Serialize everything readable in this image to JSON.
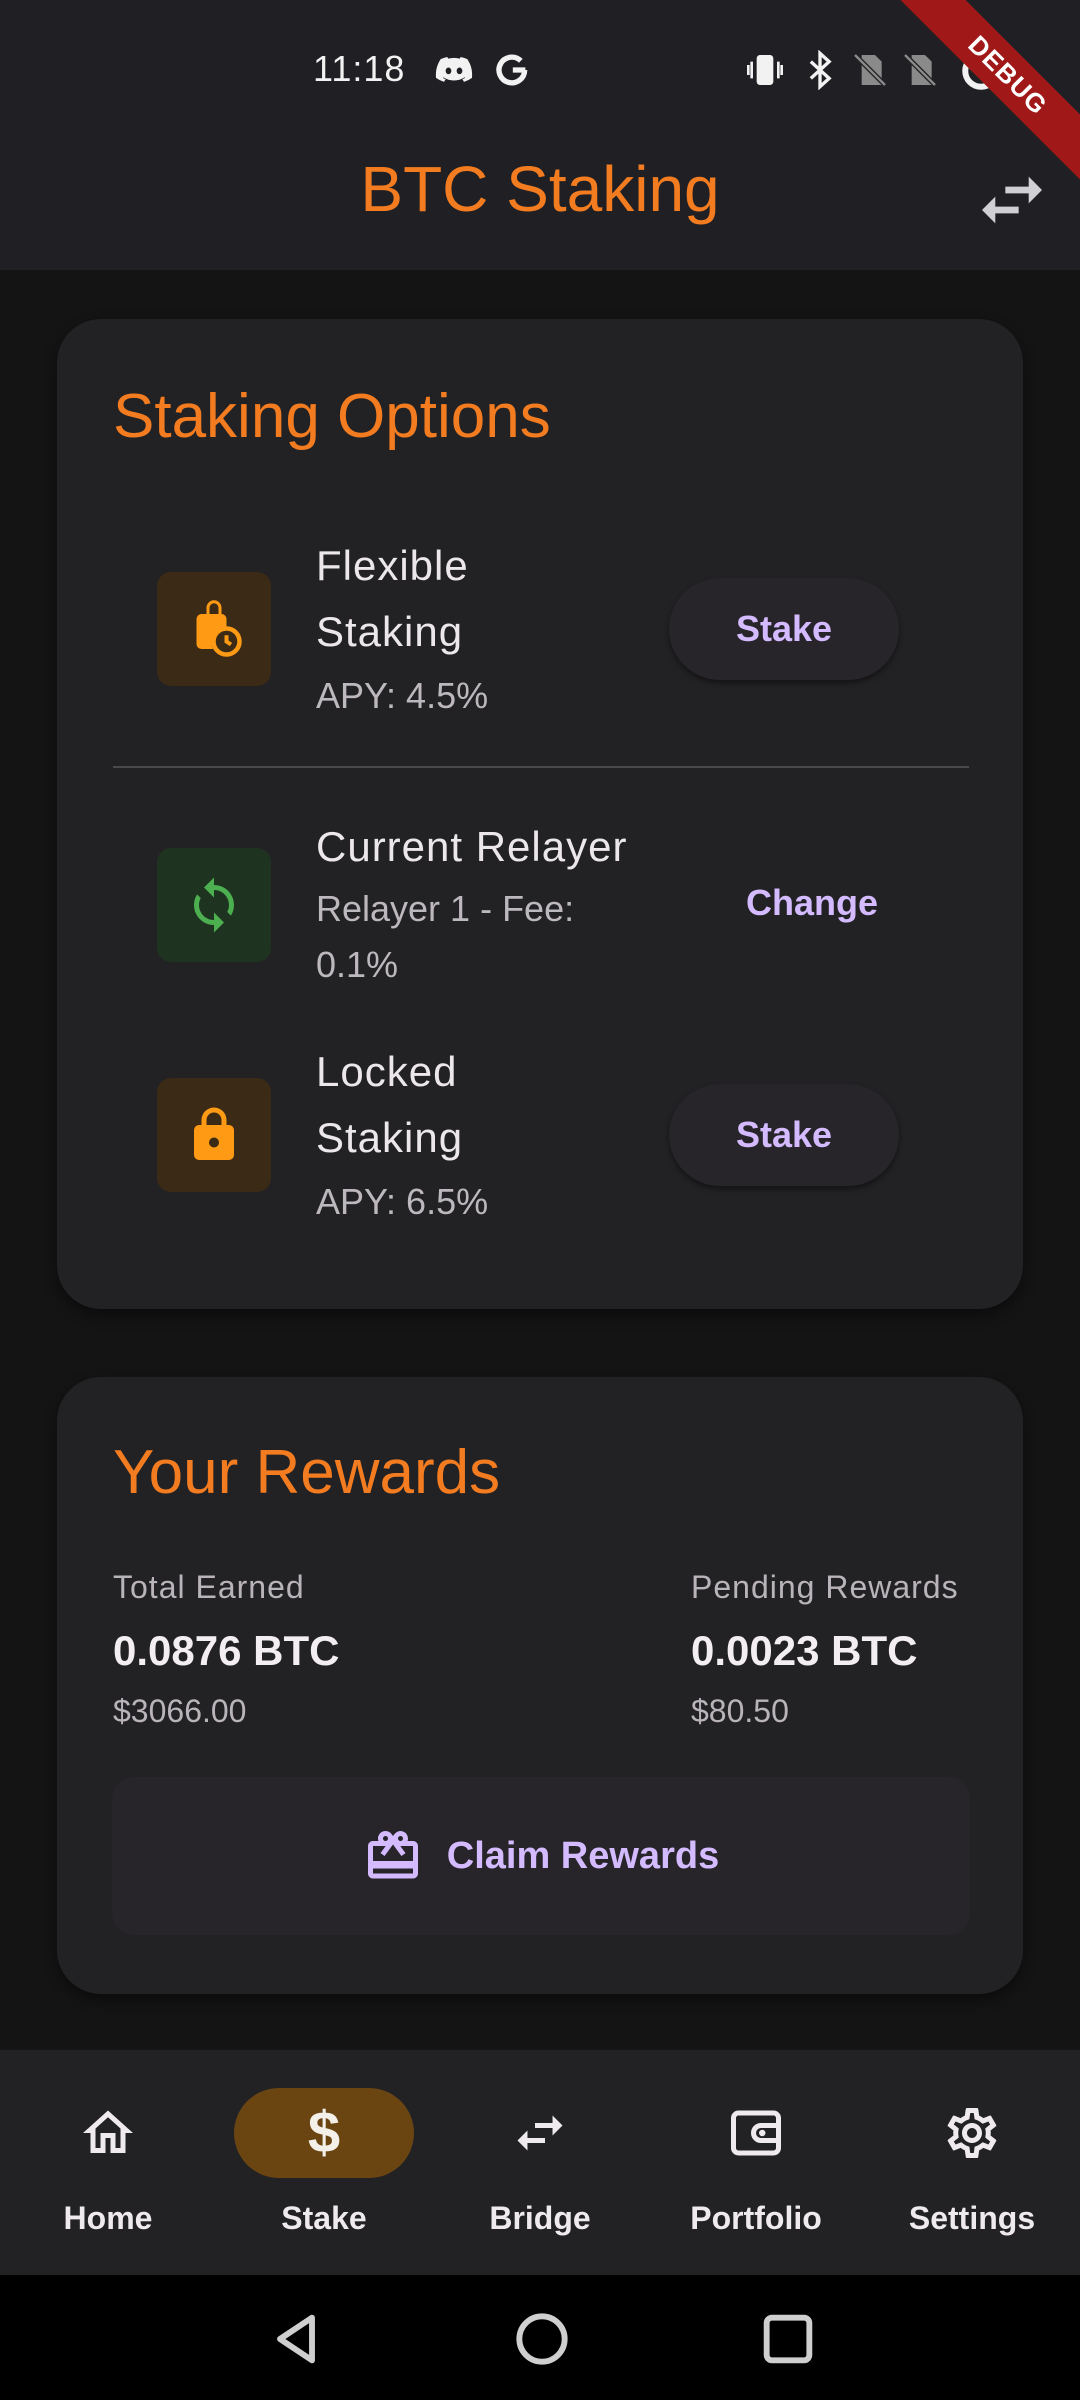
{
  "status_bar": {
    "time": "11:18",
    "icons": [
      "discord-icon",
      "google-icon",
      "vibrate-icon",
      "bluetooth-icon",
      "no-sim-icon",
      "no-sim-icon",
      "loading-icon"
    ]
  },
  "debug_banner": "DEBUG",
  "app_bar": {
    "title": "BTC Staking",
    "action_icon": "swap-horiz-icon"
  },
  "staking_options": {
    "title": "Staking Options",
    "flexible": {
      "name_line1": "Flexible",
      "name_line2": "Staking",
      "apy": "APY: 4.5%",
      "button": "Stake",
      "icon": "lock-clock-icon"
    },
    "relayer": {
      "name": "Current Relayer",
      "detail_line1": "Relayer 1 - Fee:",
      "detail_line2": "0.1%",
      "button": "Change",
      "icon": "sync-icon"
    },
    "locked": {
      "name_line1": "Locked",
      "name_line2": "Staking",
      "apy": "APY: 6.5%",
      "button": "Stake",
      "icon": "lock-icon"
    }
  },
  "rewards": {
    "title": "Your Rewards",
    "total_label": "Total Earned",
    "total_btc": "0.0876 BTC",
    "total_usd": "$3066.00",
    "pending_label": "Pending Rewards",
    "pending_btc": "0.0023 BTC",
    "pending_usd": "$80.50",
    "claim_button": "Claim Rewards",
    "claim_icon": "redeem-icon"
  },
  "bottom_nav": {
    "items": [
      {
        "label": "Home",
        "icon": "home-icon"
      },
      {
        "label": "Stake",
        "icon": "dollar-icon",
        "active": true
      },
      {
        "label": "Bridge",
        "icon": "swap-horiz-icon"
      },
      {
        "label": "Portfolio",
        "icon": "wallet-icon"
      },
      {
        "label": "Settings",
        "icon": "gear-icon"
      }
    ]
  },
  "colors": {
    "accent": "#f47c20",
    "button_text": "#d4bbff",
    "active_nav": "#6a4512",
    "orange_icon": "#ff9a14",
    "green_icon": "#4caf50"
  }
}
